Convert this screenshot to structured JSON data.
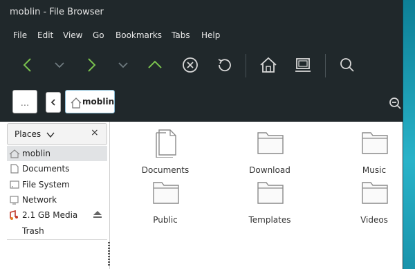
{
  "window": {
    "title": "moblin - File Browser"
  },
  "menu": [
    "File",
    "Edit",
    "View",
    "Go",
    "Bookmarks",
    "Tabs",
    "Help"
  ],
  "toolbar": {
    "icons": [
      "back-icon",
      "back-history-icon",
      "forward-icon",
      "forward-history-icon",
      "up-icon",
      "stop-icon",
      "reload-icon",
      "home-icon",
      "computer-icon",
      "search-icon"
    ],
    "accent": "#7ac24e"
  },
  "pathbar": {
    "ellipsis": "...",
    "current": "moblin"
  },
  "sidebar": {
    "header": "Places",
    "close": "×",
    "items": [
      {
        "label": "moblin",
        "icon": "home-icon"
      },
      {
        "label": "Documents",
        "icon": "document-icon"
      },
      {
        "label": "File System",
        "icon": "drive-icon"
      },
      {
        "label": "Network",
        "icon": "network-icon"
      },
      {
        "label": "2.1 GB Media",
        "icon": "media-icon"
      },
      {
        "label": "Trash",
        "icon": "trash-icon"
      }
    ]
  },
  "files": [
    {
      "name": "Documents",
      "icon": "document-icon"
    },
    {
      "name": "Download",
      "icon": "folder-icon"
    },
    {
      "name": "Music",
      "icon": "folder-icon"
    },
    {
      "name": "Public",
      "icon": "folder-icon"
    },
    {
      "name": "Templates",
      "icon": "folder-icon"
    },
    {
      "name": "Videos",
      "icon": "folder-icon"
    }
  ]
}
